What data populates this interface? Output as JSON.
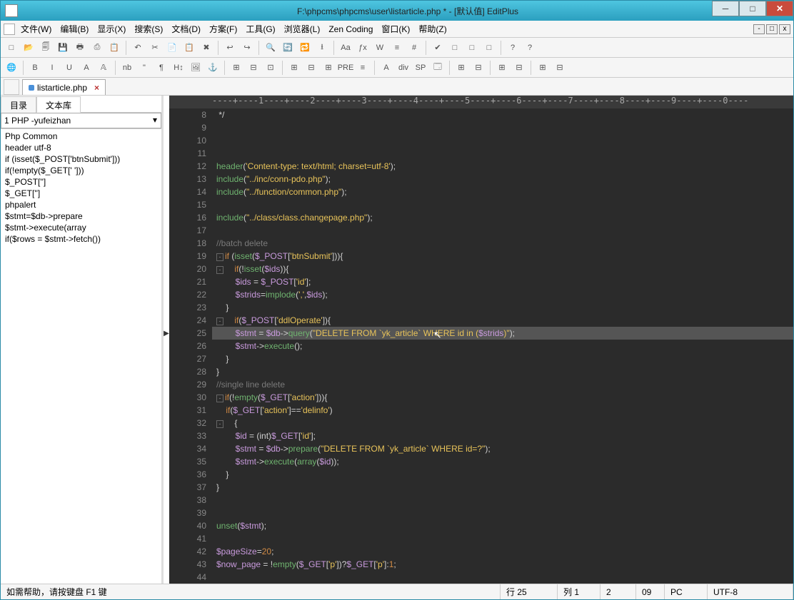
{
  "title": "F:\\phpcms\\phpcms\\user\\listarticle.php * - [默认值] EditPlus",
  "menus": [
    "文件(W)",
    "编辑(B)",
    "显示(X)",
    "搜索(S)",
    "文档(D)",
    "方案(F)",
    "工具(G)",
    "浏览器(L)",
    "Zen Coding",
    "窗口(K)",
    "帮助(Z)"
  ],
  "toolbars": {
    "row1": [
      "□",
      "📂",
      "🗐",
      "💾",
      "🖶",
      "⎙",
      "📋",
      "|",
      "↶",
      "✂",
      "📄",
      "📋",
      "✖",
      "|",
      "↩",
      "↪",
      "|",
      "🔍",
      "🔄",
      "🔁",
      "⭳",
      "|",
      "Aa",
      "ƒx",
      "W",
      "≡",
      "#",
      "|",
      "✔",
      "□",
      "□",
      "□",
      "|",
      "?",
      "?"
    ],
    "row2": [
      "🌐",
      "|",
      "B",
      "I",
      "U",
      "A",
      "𝔸",
      "|",
      "nb",
      "\"",
      "¶",
      "H↕",
      "🖼",
      "⚓",
      "|",
      "⊞",
      "⊟",
      "⊡",
      "|",
      "⊞",
      "⊟",
      "⊞",
      "PRE",
      "≡",
      "|",
      "A",
      "div",
      "SP",
      "🗔",
      "|",
      "⊞",
      "⊟",
      "|",
      "⊞",
      "⊟",
      "|",
      "⊞",
      "⊟"
    ]
  },
  "tab": {
    "name": "listarticle.php"
  },
  "sidebar": {
    "tabs": [
      "目录",
      "文本库"
    ],
    "select": "1 PHP -yufeizhan",
    "snippets": [
      "Php Common",
      "header utf-8",
      "if (isset($_POST['btnSubmit']))",
      "if(!empty($_GET[' ']))",
      "$_POST['']",
      "$_GET['']",
      "phpalert",
      "$stmt=$db->prepare",
      "$stmt->execute(array",
      "if($rows = $stmt->fetch())"
    ]
  },
  "ruler": "----+----1----+----2----+----3----+----4----+----5----+----6----+----7----+----8----+----9----+----0----",
  "code_start_line": 8,
  "cursor_line_index": 17,
  "code": [
    {
      "n": 8,
      "t": " */",
      "cls": "cm"
    },
    {
      "n": 9,
      "t": ""
    },
    {
      "n": 10,
      "t": ""
    },
    {
      "n": 11,
      "t": ""
    },
    {
      "n": 12,
      "html": "<span class='fn'>header</span>(<span class='str'>'Content-type: text/html; charset=utf-8'</span>);"
    },
    {
      "n": 13,
      "html": "<span class='fn'>include</span>(<span class='str'>\"../inc/conn-pdo.php\"</span>);"
    },
    {
      "n": 14,
      "html": "<span class='fn'>include</span>(<span class='str'>\"../function/common.php\"</span>);"
    },
    {
      "n": 15,
      "t": ""
    },
    {
      "n": 16,
      "html": "<span class='fn'>include</span>(<span class='str'>\"../class/class.changepage.php\"</span>);"
    },
    {
      "n": 17,
      "t": ""
    },
    {
      "n": 18,
      "html": "<span class='cm'>//batch delete</span>"
    },
    {
      "n": 19,
      "fold": true,
      "html": "<span class='kw'>if</span> (<span class='fn'>isset</span>(<span class='var'>$_POST</span>[<span class='str'>'btnSubmit'</span>])){"
    },
    {
      "n": 20,
      "fold": true,
      "html": "    <span class='kw'>if</span>(!<span class='fn'>isset</span>(<span class='var'>$ids</span>)){"
    },
    {
      "n": 21,
      "html": "        <span class='var'>$ids</span> = <span class='var'>$_POST</span>[<span class='str'>'id'</span>];"
    },
    {
      "n": 22,
      "html": "        <span class='var'>$strids</span>=<span class='fn'>implode</span>(<span class='str'>','</span>,<span class='var'>$ids</span>);"
    },
    {
      "n": 23,
      "html": "    }"
    },
    {
      "n": 24,
      "fold": true,
      "html": "    <span class='kw'>if</span>(<span class='var'>$_POST</span>[<span class='str'>'ddlOperate'</span>]){"
    },
    {
      "n": 25,
      "hl": true,
      "marker": true,
      "html": "        <span class='var'>$stmt</span> = <span class='var'>$db</span>-&gt;<span class='fn'>query</span>(<span class='str'>\"DELETE FROM `yk_article` WHERE id in (</span><span class='var'>$strids</span><span class='str'>)\"</span>);"
    },
    {
      "n": 26,
      "html": "        <span class='var'>$stmt</span>-&gt;<span class='fn'>execute</span>();"
    },
    {
      "n": 27,
      "html": "    }"
    },
    {
      "n": 28,
      "html": "}"
    },
    {
      "n": 29,
      "html": "<span class='cm'>//single line delete</span>"
    },
    {
      "n": 30,
      "fold": true,
      "html": "<span class='kw'>if</span>(!<span class='fn'>empty</span>(<span class='var'>$_GET</span>[<span class='str'>'action'</span>])){"
    },
    {
      "n": 31,
      "html": "    <span class='kw'>if</span>(<span class='var'>$_GET</span>[<span class='str'>'action'</span>]==<span class='str'>'delinfo'</span>)"
    },
    {
      "n": 32,
      "fold": true,
      "html": "    {"
    },
    {
      "n": 33,
      "html": "        <span class='var'>$id</span> = (int)<span class='var'>$_GET</span>[<span class='str'>'id'</span>];"
    },
    {
      "n": 34,
      "html": "        <span class='var'>$stmt</span> = <span class='var'>$db</span>-&gt;<span class='fn'>prepare</span>(<span class='str'>\"DELETE FROM `yk_article` WHERE id=?\"</span>);"
    },
    {
      "n": 35,
      "html": "        <span class='var'>$stmt</span>-&gt;<span class='fn'>execute</span>(<span class='fn'>array</span>(<span class='var'>$id</span>));"
    },
    {
      "n": 36,
      "html": "    }"
    },
    {
      "n": 37,
      "html": "}"
    },
    {
      "n": 38,
      "t": ""
    },
    {
      "n": 39,
      "t": ""
    },
    {
      "n": 40,
      "html": "<span class='fn'>unset</span>(<span class='var'>$stmt</span>);"
    },
    {
      "n": 41,
      "t": ""
    },
    {
      "n": 42,
      "html": "<span class='var'>$pageSize</span>=<span class='num'>20</span>;"
    },
    {
      "n": 43,
      "html": "<span class='var'>$now_page</span> = !<span class='fn'>empty</span>(<span class='var'>$_GET</span>[<span class='str'>'p'</span>])?<span class='var'>$_GET</span>[<span class='str'>'p'</span>]:<span class='num'>1</span>;"
    },
    {
      "n": 44,
      "t": ""
    }
  ],
  "status": {
    "help": "如需帮助，请按键盘 F1 键",
    "line": "行 25",
    "col": "列 1",
    "num2": "2",
    "num09": "09",
    "mode": "PC",
    "enc": "UTF-8"
  }
}
